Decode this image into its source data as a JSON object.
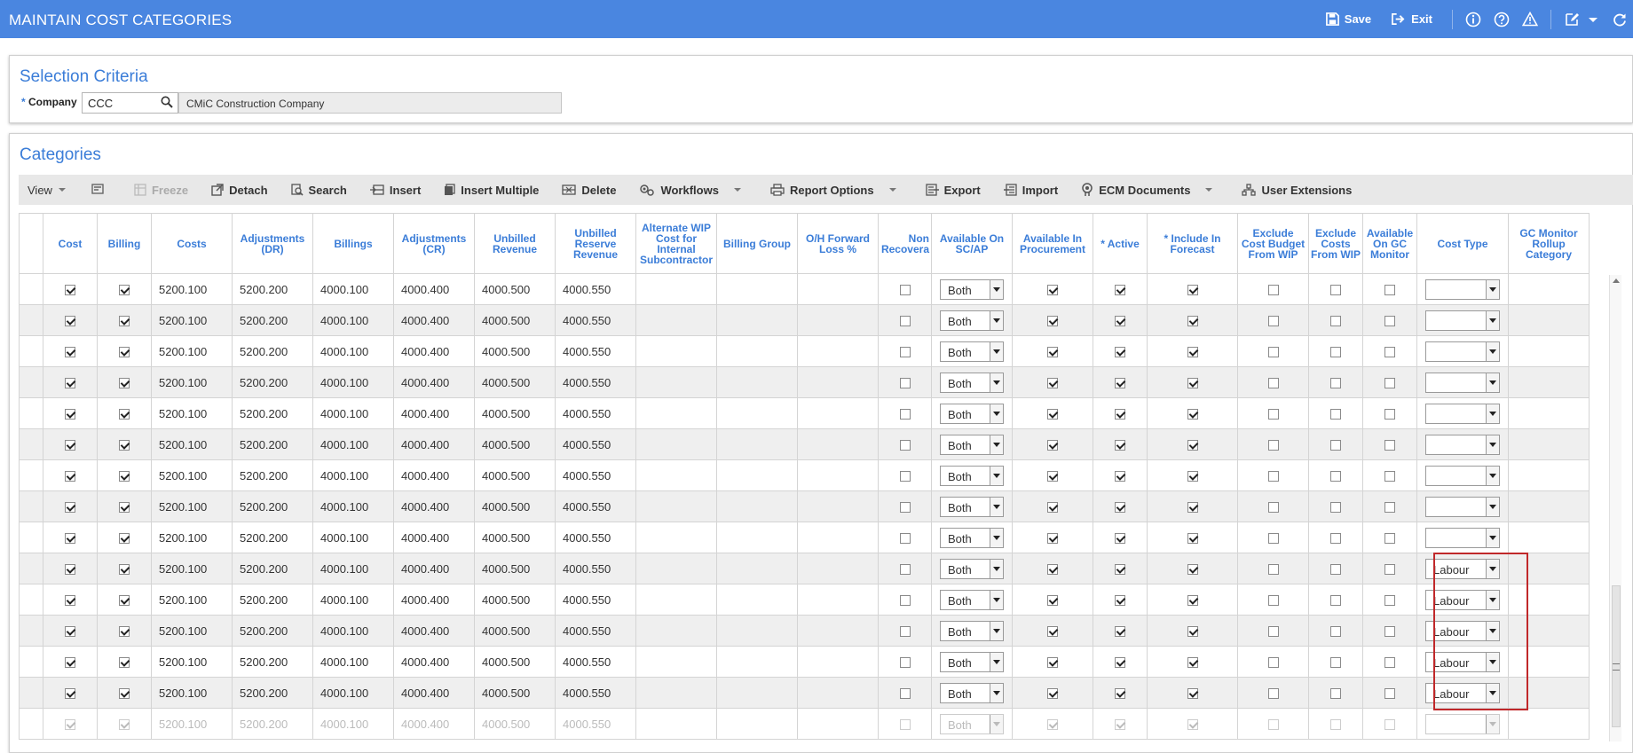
{
  "header": {
    "title": "MAINTAIN COST CATEGORIES",
    "save_label": "Save",
    "exit_label": "Exit"
  },
  "selection": {
    "title": "Selection Criteria",
    "required_mark": "*",
    "company_label": "Company",
    "company_value": "CCC",
    "company_name": "CMiC Construction Company"
  },
  "categories": {
    "title": "Categories",
    "toolbar": {
      "view": "View",
      "freeze": "Freeze",
      "detach": "Detach",
      "search": "Search",
      "insert": "Insert",
      "insert_multiple": "Insert Multiple",
      "delete": "Delete",
      "workflows": "Workflows",
      "report_options": "Report Options",
      "export": "Export",
      "import": "Import",
      "ecm_documents": "ECM Documents",
      "user_extensions": "User Extensions"
    },
    "columns": [
      "",
      "Cost",
      "Billing",
      "Costs",
      "Adjustments (DR)",
      "Billings",
      "Adjustments (CR)",
      "Unbilled Revenue",
      "Unbilled Reserve Revenue",
      "Alternate WIP Cost for Internal Subcontractor",
      "Billing Group",
      "O/H Forward Loss %",
      "Non Recovera",
      "Available On SC/AP",
      "Available In Procurement",
      "* Active",
      "* Include In Forecast",
      "Exclude Cost Budget From WIP",
      "Exclude Costs From WIP",
      "Available On GC Monitor",
      "Cost Type",
      "GC Monitor Rollup Category"
    ],
    "rows": [
      {
        "cost": true,
        "billing": true,
        "costs": "5200.100",
        "adj_dr": "5200.200",
        "billings": "4000.100",
        "adj_cr": "4000.400",
        "unbilled": "4000.500",
        "reserve": "4000.550",
        "available_on": "Both",
        "procurement": true,
        "active": true,
        "forecast": true,
        "cost_type": ""
      },
      {
        "cost": true,
        "billing": true,
        "costs": "5200.100",
        "adj_dr": "5200.200",
        "billings": "4000.100",
        "adj_cr": "4000.400",
        "unbilled": "4000.500",
        "reserve": "4000.550",
        "available_on": "Both",
        "procurement": true,
        "active": true,
        "forecast": true,
        "cost_type": ""
      },
      {
        "cost": true,
        "billing": true,
        "costs": "5200.100",
        "adj_dr": "5200.200",
        "billings": "4000.100",
        "adj_cr": "4000.400",
        "unbilled": "4000.500",
        "reserve": "4000.550",
        "available_on": "Both",
        "procurement": true,
        "active": true,
        "forecast": true,
        "cost_type": ""
      },
      {
        "cost": true,
        "billing": true,
        "costs": "5200.100",
        "adj_dr": "5200.200",
        "billings": "4000.100",
        "adj_cr": "4000.400",
        "unbilled": "4000.500",
        "reserve": "4000.550",
        "available_on": "Both",
        "procurement": true,
        "active": true,
        "forecast": true,
        "cost_type": ""
      },
      {
        "cost": true,
        "billing": true,
        "costs": "5200.100",
        "adj_dr": "5200.200",
        "billings": "4000.100",
        "adj_cr": "4000.400",
        "unbilled": "4000.500",
        "reserve": "4000.550",
        "available_on": "Both",
        "procurement": true,
        "active": true,
        "forecast": true,
        "cost_type": ""
      },
      {
        "cost": true,
        "billing": true,
        "costs": "5200.100",
        "adj_dr": "5200.200",
        "billings": "4000.100",
        "adj_cr": "4000.400",
        "unbilled": "4000.500",
        "reserve": "4000.550",
        "available_on": "Both",
        "procurement": true,
        "active": true,
        "forecast": true,
        "cost_type": ""
      },
      {
        "cost": true,
        "billing": true,
        "costs": "5200.100",
        "adj_dr": "5200.200",
        "billings": "4000.100",
        "adj_cr": "4000.400",
        "unbilled": "4000.500",
        "reserve": "4000.550",
        "available_on": "Both",
        "procurement": true,
        "active": true,
        "forecast": true,
        "cost_type": ""
      },
      {
        "cost": true,
        "billing": true,
        "costs": "5200.100",
        "adj_dr": "5200.200",
        "billings": "4000.100",
        "adj_cr": "4000.400",
        "unbilled": "4000.500",
        "reserve": "4000.550",
        "available_on": "Both",
        "procurement": true,
        "active": true,
        "forecast": true,
        "cost_type": ""
      },
      {
        "cost": true,
        "billing": true,
        "costs": "5200.100",
        "adj_dr": "5200.200",
        "billings": "4000.100",
        "adj_cr": "4000.400",
        "unbilled": "4000.500",
        "reserve": "4000.550",
        "available_on": "Both",
        "procurement": true,
        "active": true,
        "forecast": true,
        "cost_type": ""
      },
      {
        "cost": true,
        "billing": true,
        "costs": "5200.100",
        "adj_dr": "5200.200",
        "billings": "4000.100",
        "adj_cr": "4000.400",
        "unbilled": "4000.500",
        "reserve": "4000.550",
        "available_on": "Both",
        "procurement": true,
        "active": true,
        "forecast": true,
        "cost_type": "Labour"
      },
      {
        "cost": true,
        "billing": true,
        "costs": "5200.100",
        "adj_dr": "5200.200",
        "billings": "4000.100",
        "adj_cr": "4000.400",
        "unbilled": "4000.500",
        "reserve": "4000.550",
        "available_on": "Both",
        "procurement": true,
        "active": true,
        "forecast": true,
        "cost_type": "Labour"
      },
      {
        "cost": true,
        "billing": true,
        "costs": "5200.100",
        "adj_dr": "5200.200",
        "billings": "4000.100",
        "adj_cr": "4000.400",
        "unbilled": "4000.500",
        "reserve": "4000.550",
        "available_on": "Both",
        "procurement": true,
        "active": true,
        "forecast": true,
        "cost_type": "Labour"
      },
      {
        "cost": true,
        "billing": true,
        "costs": "5200.100",
        "adj_dr": "5200.200",
        "billings": "4000.100",
        "adj_cr": "4000.400",
        "unbilled": "4000.500",
        "reserve": "4000.550",
        "available_on": "Both",
        "procurement": true,
        "active": true,
        "forecast": true,
        "cost_type": "Labour"
      },
      {
        "cost": true,
        "billing": true,
        "costs": "5200.100",
        "adj_dr": "5200.200",
        "billings": "4000.100",
        "adj_cr": "4000.400",
        "unbilled": "4000.500",
        "reserve": "4000.550",
        "available_on": "Both",
        "procurement": true,
        "active": true,
        "forecast": true,
        "cost_type": "Labour"
      },
      {
        "cost": true,
        "billing": true,
        "costs": "5200.100",
        "adj_dr": "5200.200",
        "billings": "4000.100",
        "adj_cr": "4000.400",
        "unbilled": "4000.500",
        "reserve": "4000.550",
        "available_on": "Both",
        "procurement": true,
        "active": true,
        "forecast": true,
        "cost_type": "",
        "faded": true
      }
    ]
  },
  "colors": {
    "header_bg": "#4a86e0",
    "accent": "#3b7dd8",
    "highlight_border": "#c0282a",
    "toolbar_bg": "#e8e8e8"
  },
  "icons": [
    "save-icon",
    "exit-icon",
    "info-icon",
    "help-icon",
    "warning-icon",
    "edit-icon",
    "refresh-icon",
    "search-icon",
    "freeze-icon",
    "detach-icon",
    "insert-icon",
    "delete-icon",
    "workflows-icon",
    "print-icon",
    "export-icon",
    "import-icon",
    "ecm-icon",
    "user-extensions-icon"
  ]
}
